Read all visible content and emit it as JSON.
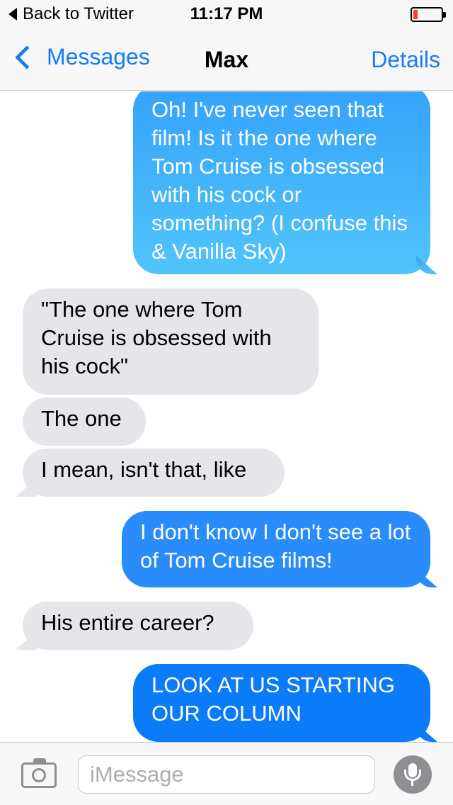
{
  "status_bar": {
    "back_to_app": "Back to Twitter",
    "time": "11:17 PM",
    "battery_level": 0.15
  },
  "nav": {
    "back_label": "Messages",
    "title": "Max",
    "details_label": "Details"
  },
  "messages": [
    {
      "direction": "outgoing",
      "text": "Oh! I've never seen that film! Is it the one where Tom Cruise is obsessed with his cock or something? (I confuse this & Vanilla Sky)"
    },
    {
      "direction": "incoming",
      "text": "\"The one where Tom Cruise is obsessed with his cock\""
    },
    {
      "direction": "incoming",
      "text": "The one"
    },
    {
      "direction": "incoming",
      "text": "I mean, isn't that, like"
    },
    {
      "direction": "outgoing",
      "text": "I don't know I don't see a lot of Tom Cruise films!"
    },
    {
      "direction": "incoming",
      "text": "His entire career?"
    },
    {
      "direction": "outgoing",
      "text": "LOOK AT US STARTING OUR COLUMN"
    }
  ],
  "input": {
    "placeholder": "iMessage"
  },
  "icons": {
    "back_app": "back-triangle-icon",
    "battery": "battery-icon",
    "nav_back": "chevron-left-icon",
    "camera": "camera-icon",
    "mic": "microphone-icon"
  },
  "colors": {
    "accent": "#1a7cf5",
    "outgoing_bubble": "#1c8bfb",
    "incoming_bubble": "#e5e5ea",
    "battery_low": "#ff3b30"
  }
}
